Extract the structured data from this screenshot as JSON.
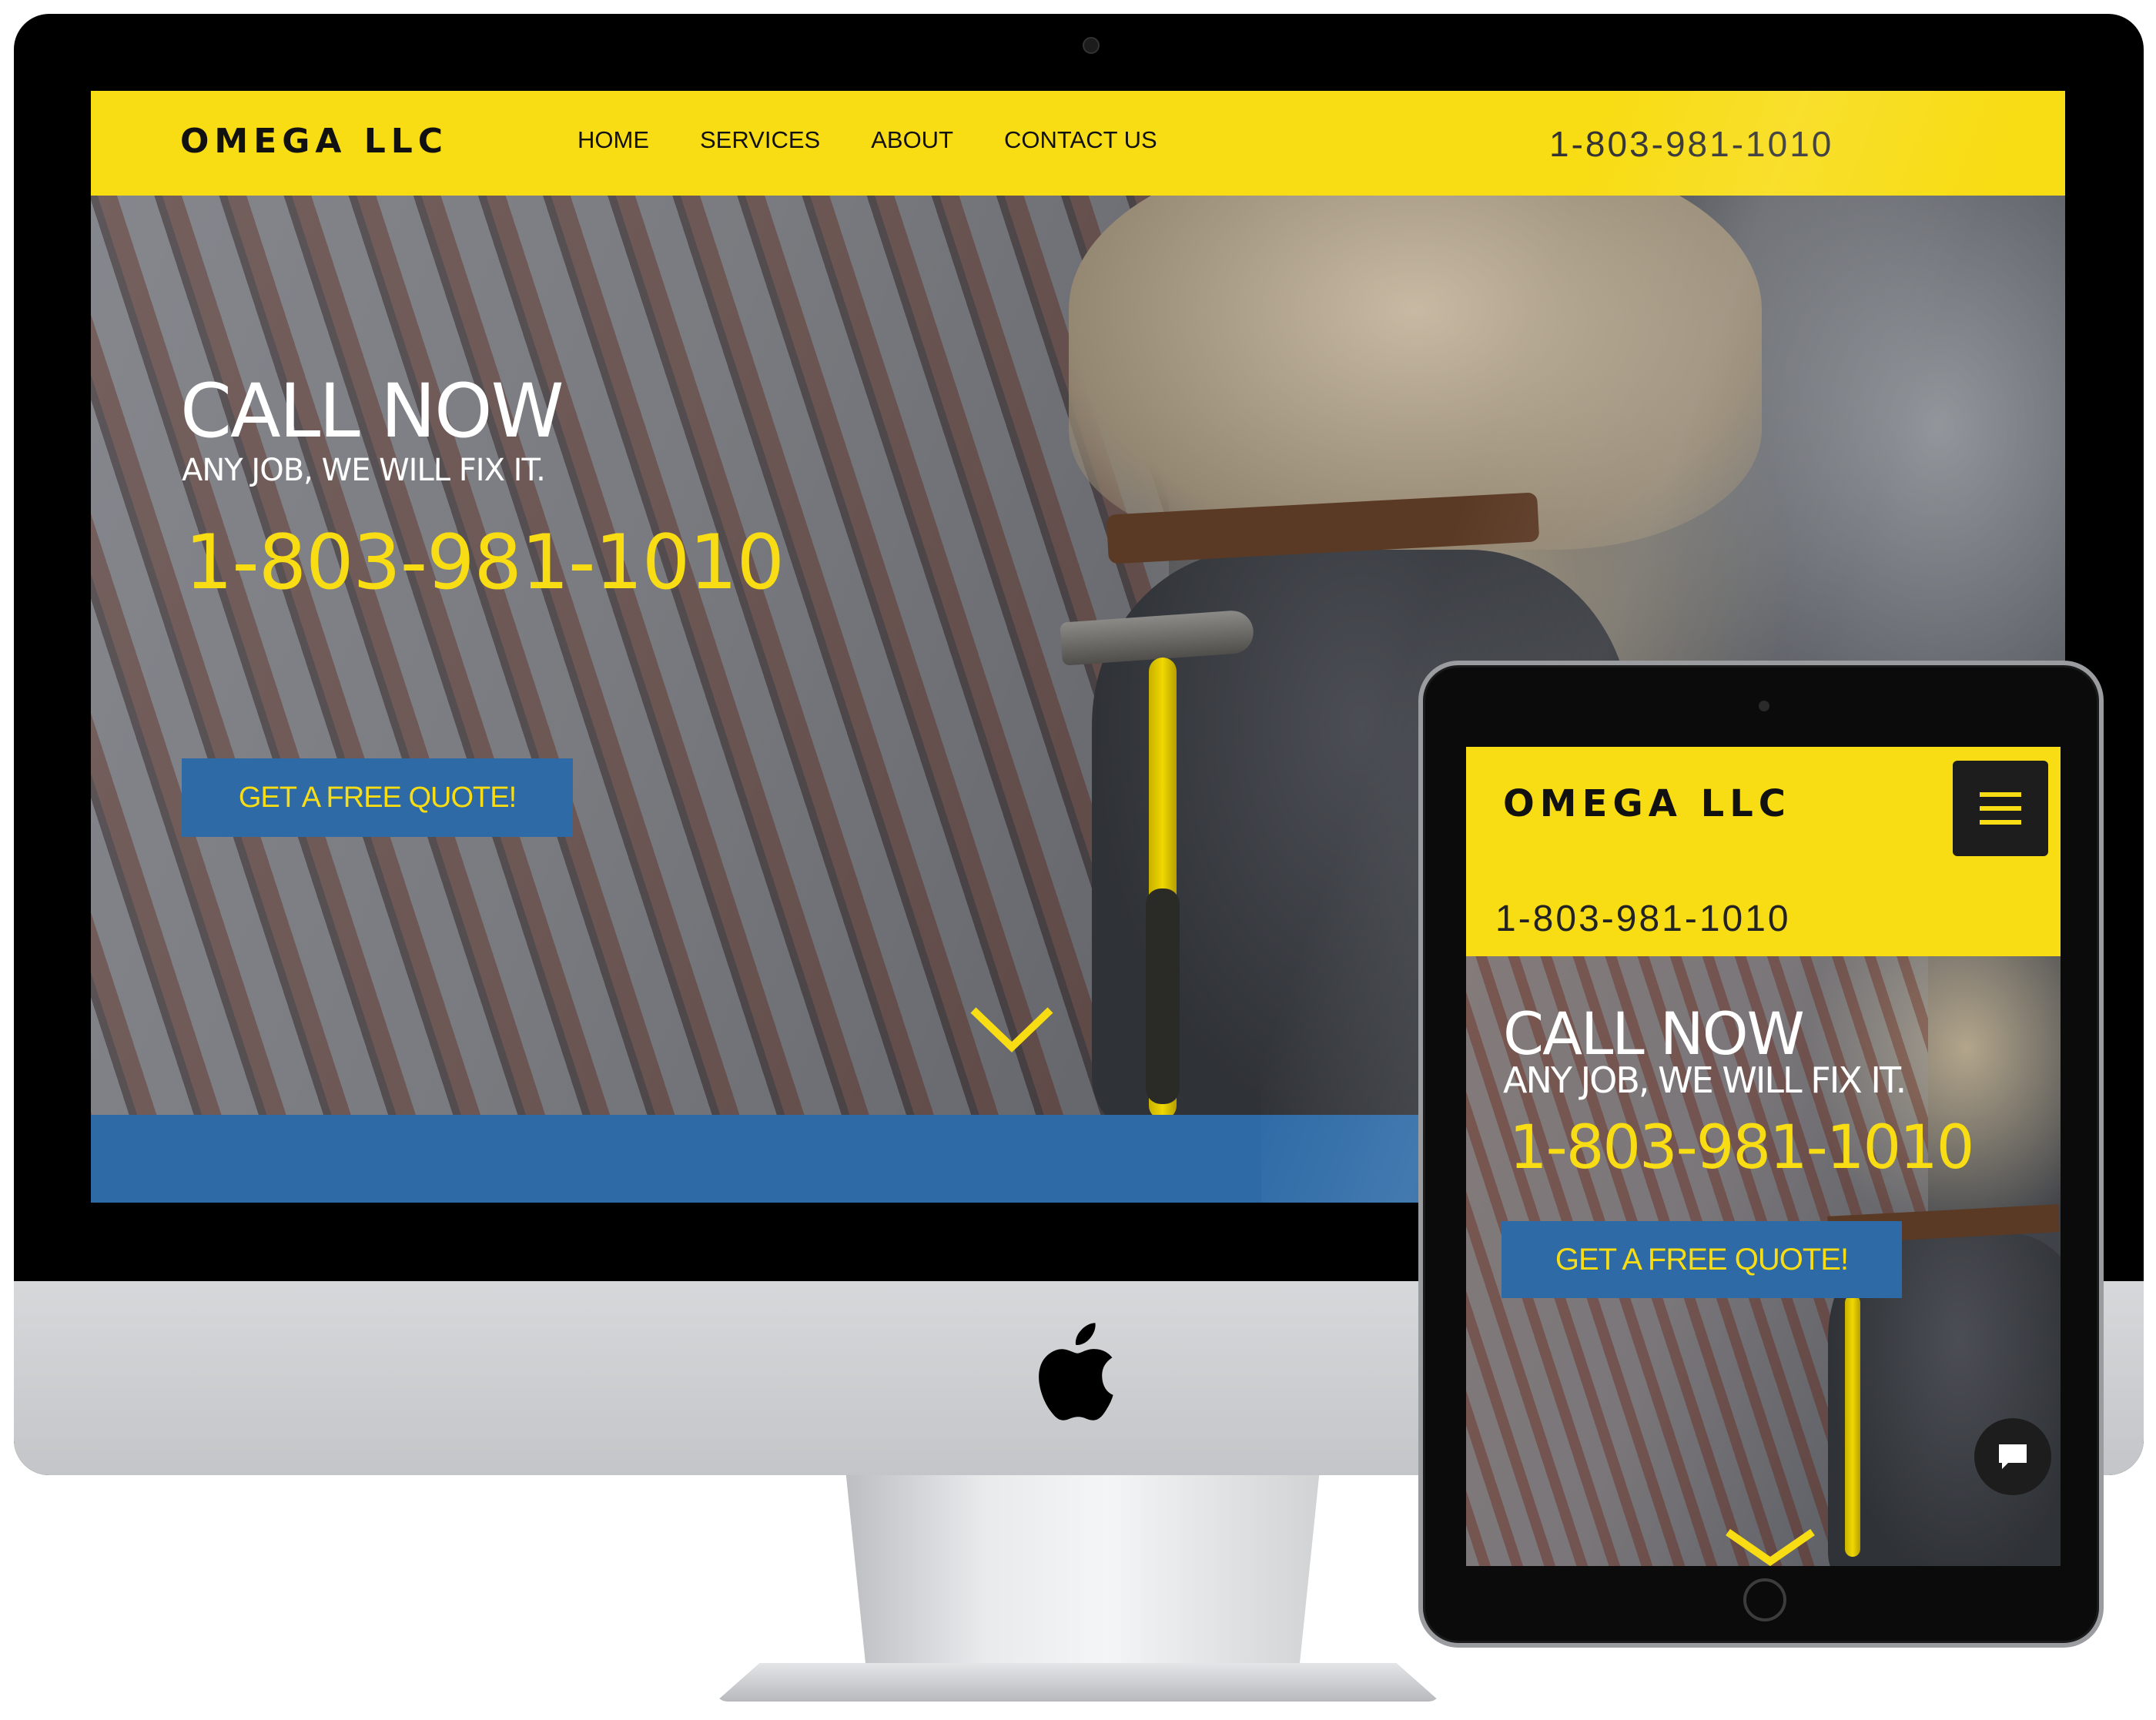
{
  "desktop": {
    "header": {
      "logo": "OMEGA LLC",
      "nav": [
        "HOME",
        "SERVICES",
        "ABOUT",
        "CONTACT US"
      ],
      "phone": "1-803-981-1010"
    },
    "hero": {
      "headline": "CALL NOW",
      "subheadline": "ANY JOB, WE WILL FIX IT.",
      "phone": "1-803-981-1010",
      "cta_label": "GET A FREE QUOTE!"
    }
  },
  "tablet": {
    "header": {
      "logo": "OMEGA LLC",
      "menu_icon": "hamburger-menu-icon",
      "phone": "1-803-981-1010"
    },
    "hero": {
      "headline": "CALL NOW",
      "subheadline": "ANY JOB, WE WILL FIX IT.",
      "phone": "1-803-981-1010",
      "cta_label": "GET A FREE QUOTE!"
    },
    "chat_icon": "chat-bubble-icon"
  },
  "colors": {
    "brand_yellow": "#f8dc14",
    "brand_blue": "#2d6aa6",
    "dark": "#1d1d1d"
  }
}
